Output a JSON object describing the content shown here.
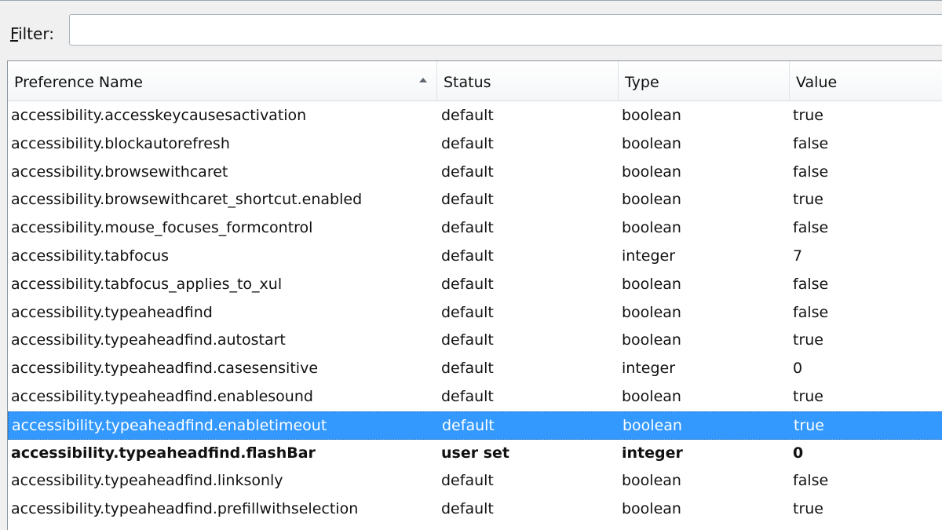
{
  "filter": {
    "label_ul": "F",
    "label_rest": "ilter:",
    "value": "",
    "placeholder": ""
  },
  "columns": {
    "name": "Preference Name",
    "status": "Status",
    "type": "Type",
    "value": "Value"
  },
  "rows": [
    {
      "name": "accessibility.accesskeycausesactivation",
      "status": "default",
      "type": "boolean",
      "value": "true"
    },
    {
      "name": "accessibility.blockautorefresh",
      "status": "default",
      "type": "boolean",
      "value": "false"
    },
    {
      "name": "accessibility.browsewithcaret",
      "status": "default",
      "type": "boolean",
      "value": "false"
    },
    {
      "name": "accessibility.browsewithcaret_shortcut.enabled",
      "status": "default",
      "type": "boolean",
      "value": "true"
    },
    {
      "name": "accessibility.mouse_focuses_formcontrol",
      "status": "default",
      "type": "boolean",
      "value": "false"
    },
    {
      "name": "accessibility.tabfocus",
      "status": "default",
      "type": "integer",
      "value": "7"
    },
    {
      "name": "accessibility.tabfocus_applies_to_xul",
      "status": "default",
      "type": "boolean",
      "value": "false"
    },
    {
      "name": "accessibility.typeaheadfind",
      "status": "default",
      "type": "boolean",
      "value": "false"
    },
    {
      "name": "accessibility.typeaheadfind.autostart",
      "status": "default",
      "type": "boolean",
      "value": "true"
    },
    {
      "name": "accessibility.typeaheadfind.casesensitive",
      "status": "default",
      "type": "integer",
      "value": "0"
    },
    {
      "name": "accessibility.typeaheadfind.enablesound",
      "status": "default",
      "type": "boolean",
      "value": "true"
    },
    {
      "name": "accessibility.typeaheadfind.enabletimeout",
      "status": "default",
      "type": "boolean",
      "value": "true"
    },
    {
      "name": "accessibility.typeaheadfind.flashBar",
      "status": "user set",
      "type": "integer",
      "value": "0"
    },
    {
      "name": "accessibility.typeaheadfind.linksonly",
      "status": "default",
      "type": "boolean",
      "value": "false"
    },
    {
      "name": "accessibility.typeaheadfind.prefillwithselection",
      "status": "default",
      "type": "boolean",
      "value": "true"
    }
  ],
  "selected_row": 11,
  "colors": {
    "selection": "#3399ff",
    "selection_text": "#ffffff"
  },
  "icons": {
    "sort": "sort-ascending-icon"
  }
}
